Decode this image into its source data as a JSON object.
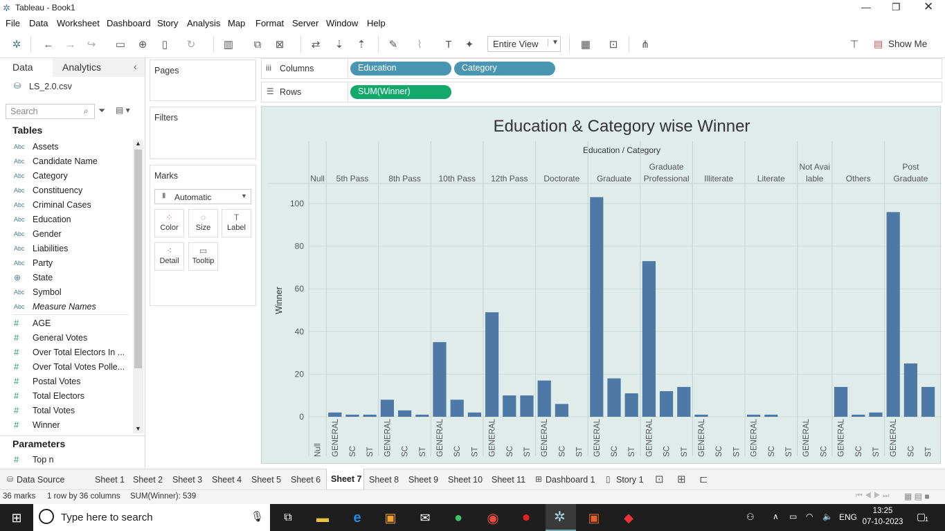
{
  "window": {
    "title": "Tableau - Book1"
  },
  "menu": [
    "File",
    "Data",
    "Worksheet",
    "Dashboard",
    "Story",
    "Analysis",
    "Map",
    "Format",
    "Server",
    "Window",
    "Help"
  ],
  "toolbar": {
    "fit": "Entire View",
    "show_me": "Show Me"
  },
  "left": {
    "tab_data": "Data",
    "tab_analytics": "Analytics",
    "datasource": "LS_2.0.csv",
    "search_placeholder": "Search",
    "tables_header": "Tables",
    "dimensions": [
      "Assets",
      "Candidate Name",
      "Category",
      "Constituency",
      "Criminal Cases",
      "Education",
      "Gender",
      "Liabilities",
      "Party",
      "State",
      "Symbol",
      "Measure Names"
    ],
    "dim_type": "Abc",
    "measures": [
      "AGE",
      "General Votes",
      "Over Total Electors  In ...",
      "Over Total Votes Polle...",
      "Postal Votes",
      "Total Electors",
      "Total Votes",
      "Winner"
    ],
    "measure_type": "#",
    "params_header": "Parameters",
    "params": [
      "Top n"
    ]
  },
  "cards": {
    "pages": "Pages",
    "filters": "Filters",
    "marks": "Marks",
    "mark_type": "Automatic",
    "buttons": [
      "Color",
      "Size",
      "Label",
      "Detail",
      "Tooltip"
    ]
  },
  "shelves": {
    "columns_label": "Columns",
    "rows_label": "Rows",
    "columns": [
      "Education",
      "Category"
    ],
    "rows": [
      "SUM(Winner)"
    ]
  },
  "chart_data": {
    "type": "bar",
    "title": "Education & Category wise Winner",
    "header": "Education / Category",
    "ylabel": "Winner",
    "ylim": [
      0,
      110
    ],
    "yticks": [
      0,
      20,
      40,
      60,
      80,
      100
    ],
    "groups": [
      {
        "name": "Null",
        "cats": [
          "Null"
        ],
        "values": [
          0
        ]
      },
      {
        "name": "5th Pass",
        "cats": [
          "GENERAL",
          "SC",
          "ST"
        ],
        "values": [
          2,
          1,
          1
        ]
      },
      {
        "name": "8th Pass",
        "cats": [
          "GENERAL",
          "SC",
          "ST"
        ],
        "values": [
          8,
          3,
          1
        ]
      },
      {
        "name": "10th Pass",
        "cats": [
          "GENERAL",
          "SC",
          "ST"
        ],
        "values": [
          35,
          8,
          2
        ]
      },
      {
        "name": "12th Pass",
        "cats": [
          "GENERAL",
          "SC",
          "ST"
        ],
        "values": [
          49,
          10,
          10
        ]
      },
      {
        "name": "Doctorate",
        "cats": [
          "GENERAL",
          "SC",
          "ST"
        ],
        "values": [
          17,
          6,
          0
        ]
      },
      {
        "name": "Graduate",
        "cats": [
          "GENERAL",
          "SC",
          "ST"
        ],
        "values": [
          103,
          18,
          11
        ]
      },
      {
        "name": "Graduate Professional",
        "cats": [
          "GENERAL",
          "SC",
          "ST"
        ],
        "values": [
          73,
          12,
          14
        ]
      },
      {
        "name": "Illiterate",
        "cats": [
          "GENERAL",
          "SC",
          "ST"
        ],
        "values": [
          1,
          0,
          0
        ]
      },
      {
        "name": "Literate",
        "cats": [
          "GENERAL",
          "SC",
          "ST"
        ],
        "values": [
          1,
          1,
          0
        ]
      },
      {
        "name": "Not Available",
        "cats": [
          "GENERAL",
          "SC"
        ],
        "values": [
          0,
          0
        ]
      },
      {
        "name": "Others",
        "cats": [
          "GENERAL",
          "SC",
          "ST"
        ],
        "values": [
          14,
          1,
          2
        ]
      },
      {
        "name": "Post Graduate",
        "cats": [
          "GENERAL",
          "SC",
          "ST"
        ],
        "values": [
          96,
          25,
          14
        ]
      }
    ],
    "bar_color": "#4e79a7"
  },
  "sheet_tabs": [
    "Data Source",
    "Sheet 1",
    "Sheet 2",
    "Sheet 3",
    "Sheet 4",
    "Sheet 5",
    "Sheet 6",
    "Sheet 7",
    "Sheet 8",
    "Sheet 9",
    "Sheet 10",
    "Sheet 11",
    "Dashboard 1",
    "Story 1"
  ],
  "active_sheet": "Sheet 7",
  "status": {
    "marks": "36 marks",
    "dims": "1 row by 36 columns",
    "sum": "SUM(Winner): 539"
  },
  "taskbar": {
    "search_placeholder": "Type here to search",
    "lang": "ENG",
    "time": "13:25",
    "date": "07-10-2023",
    "notif": "1"
  }
}
